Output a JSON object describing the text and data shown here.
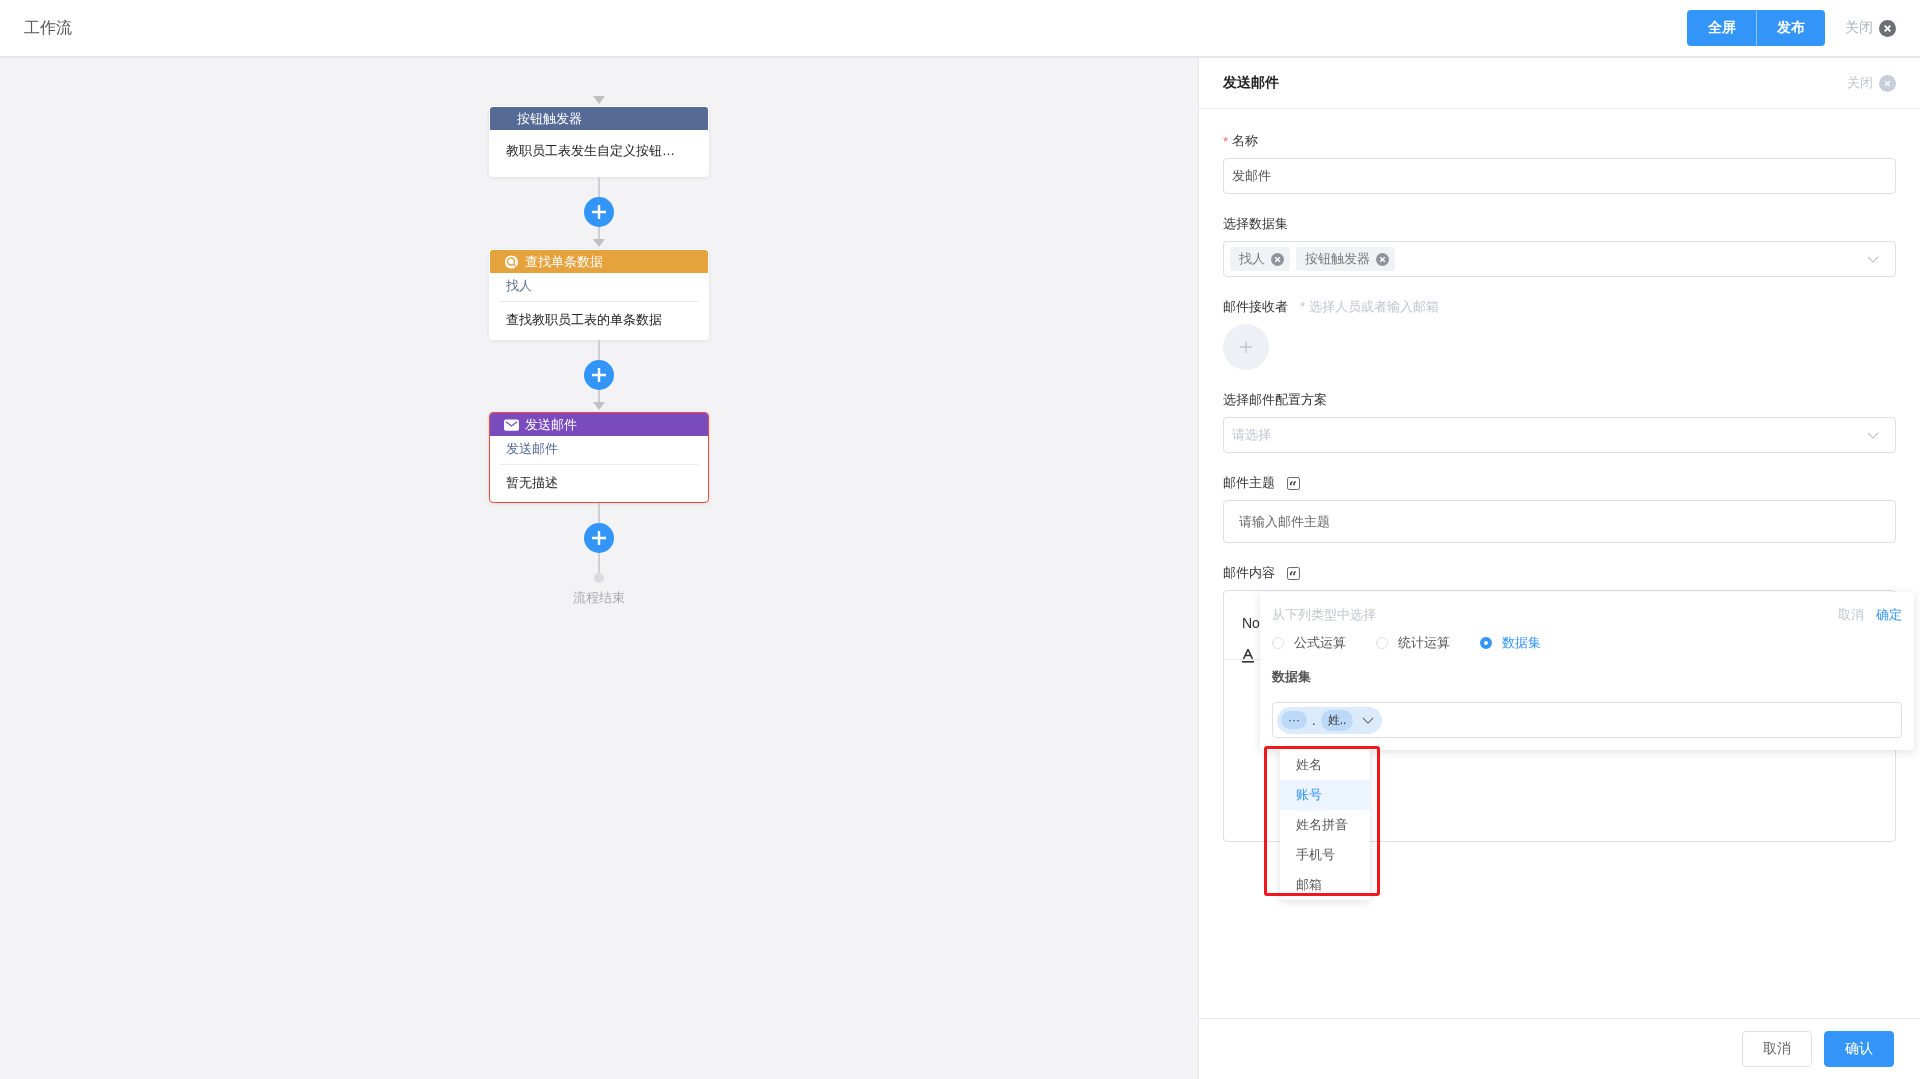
{
  "header": {
    "title": "工作流",
    "buttons": [
      {
        "label": "全屏"
      },
      {
        "label": "发布"
      }
    ],
    "close_label": "关闭"
  },
  "flow": {
    "nodes": [
      {
        "kind": "trigger",
        "header": "按钮触发器",
        "description": "教职员工表发生自定义按钮…",
        "selected": false,
        "color": "#566a96"
      },
      {
        "kind": "query",
        "header": "查找单条数据",
        "subtitle": "找人",
        "description": "查找教职员工表的单条数据",
        "selected": false,
        "color": "#e6a23c"
      },
      {
        "kind": "email",
        "header": "发送邮件",
        "subtitle": "发送邮件",
        "description": "暂无描述",
        "selected": true,
        "color": "#7a4bbd"
      }
    ],
    "end_label": "流程结束"
  },
  "panel": {
    "title": "发送邮件",
    "close_label": "关闭",
    "fields": [
      {
        "kind": "text",
        "label": "名称",
        "required": true,
        "required_mark": "*",
        "value": "发邮件"
      },
      {
        "kind": "tags",
        "label": "选择数据集",
        "tags": [
          "找人",
          "按钮触发器"
        ]
      },
      {
        "kind": "recipients",
        "label": "邮件接收者",
        "hint": "* 选择人员或者输入邮箱"
      },
      {
        "kind": "select",
        "label": "选择邮件配置方案",
        "placeholder": "请选择"
      },
      {
        "kind": "variable-input",
        "label": "邮件主题",
        "placeholder": "请输入邮件主题"
      },
      {
        "kind": "editor",
        "label": "邮件内容",
        "value": "No"
      }
    ],
    "cancel": "取消",
    "confirm": "确认"
  },
  "popup": {
    "title": "从下列类型中选择",
    "cancel": "取消",
    "confirm": "确定",
    "options": [
      {
        "label": "公式运算",
        "selected": false
      },
      {
        "label": "统计运算",
        "selected": false
      },
      {
        "label": "数据集",
        "selected": true
      }
    ],
    "section_label": "数据集",
    "chips": [
      "···",
      "姓.."
    ],
    "separator": ".",
    "dropdown": [
      {
        "label": "姓名",
        "selected": false
      },
      {
        "label": "账号",
        "selected": true
      },
      {
        "label": "姓名拼音",
        "selected": false
      },
      {
        "label": "手机号",
        "selected": false
      },
      {
        "label": "邮箱",
        "selected": false
      }
    ]
  }
}
